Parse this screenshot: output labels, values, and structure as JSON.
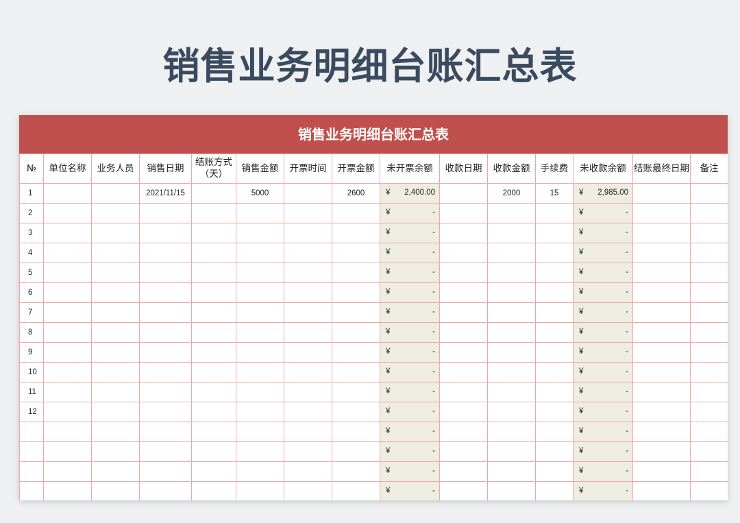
{
  "title": "销售业务明细台账汇总表",
  "sheet_title": "销售业务明细台账汇总表",
  "columns": [
    "№",
    "单位名称",
    "业务人员",
    "销售日期",
    "结账方式（天）",
    "销售金额",
    "开票时间",
    "开票金额",
    "未开票余额",
    "收款日期",
    "收款金额",
    "手续费",
    "未收款余额",
    "结账最终日期",
    "备注"
  ],
  "rows": [
    {
      "no": "1",
      "unit": "",
      "staff": "",
      "sale_date": "2021/11/15",
      "terms": "",
      "sale_amount": "5000",
      "invoice_time": "",
      "invoice_amount": "2600",
      "uninvoiced_symbol": "¥",
      "uninvoiced": "2,400.00",
      "receipt_date": "",
      "receipt_amount": "2000",
      "fee": "15",
      "unreceived_symbol": "¥",
      "unreceived": "2,985.00",
      "final_date": "",
      "note": ""
    },
    {
      "no": "2",
      "unit": "",
      "staff": "",
      "sale_date": "",
      "terms": "",
      "sale_amount": "",
      "invoice_time": "",
      "invoice_amount": "",
      "uninvoiced_symbol": "¥",
      "uninvoiced": "-",
      "receipt_date": "",
      "receipt_amount": "",
      "fee": "",
      "unreceived_symbol": "¥",
      "unreceived": "-",
      "final_date": "",
      "note": ""
    },
    {
      "no": "3",
      "unit": "",
      "staff": "",
      "sale_date": "",
      "terms": "",
      "sale_amount": "",
      "invoice_time": "",
      "invoice_amount": "",
      "uninvoiced_symbol": "¥",
      "uninvoiced": "-",
      "receipt_date": "",
      "receipt_amount": "",
      "fee": "",
      "unreceived_symbol": "¥",
      "unreceived": "-",
      "final_date": "",
      "note": ""
    },
    {
      "no": "4",
      "unit": "",
      "staff": "",
      "sale_date": "",
      "terms": "",
      "sale_amount": "",
      "invoice_time": "",
      "invoice_amount": "",
      "uninvoiced_symbol": "¥",
      "uninvoiced": "-",
      "receipt_date": "",
      "receipt_amount": "",
      "fee": "",
      "unreceived_symbol": "¥",
      "unreceived": "-",
      "final_date": "",
      "note": ""
    },
    {
      "no": "5",
      "unit": "",
      "staff": "",
      "sale_date": "",
      "terms": "",
      "sale_amount": "",
      "invoice_time": "",
      "invoice_amount": "",
      "uninvoiced_symbol": "¥",
      "uninvoiced": "-",
      "receipt_date": "",
      "receipt_amount": "",
      "fee": "",
      "unreceived_symbol": "¥",
      "unreceived": "-",
      "final_date": "",
      "note": ""
    },
    {
      "no": "6",
      "unit": "",
      "staff": "",
      "sale_date": "",
      "terms": "",
      "sale_amount": "",
      "invoice_time": "",
      "invoice_amount": "",
      "uninvoiced_symbol": "¥",
      "uninvoiced": "-",
      "receipt_date": "",
      "receipt_amount": "",
      "fee": "",
      "unreceived_symbol": "¥",
      "unreceived": "-",
      "final_date": "",
      "note": ""
    },
    {
      "no": "7",
      "unit": "",
      "staff": "",
      "sale_date": "",
      "terms": "",
      "sale_amount": "",
      "invoice_time": "",
      "invoice_amount": "",
      "uninvoiced_symbol": "¥",
      "uninvoiced": "-",
      "receipt_date": "",
      "receipt_amount": "",
      "fee": "",
      "unreceived_symbol": "¥",
      "unreceived": "-",
      "final_date": "",
      "note": ""
    },
    {
      "no": "8",
      "unit": "",
      "staff": "",
      "sale_date": "",
      "terms": "",
      "sale_amount": "",
      "invoice_time": "",
      "invoice_amount": "",
      "uninvoiced_symbol": "¥",
      "uninvoiced": "-",
      "receipt_date": "",
      "receipt_amount": "",
      "fee": "",
      "unreceived_symbol": "¥",
      "unreceived": "-",
      "final_date": "",
      "note": ""
    },
    {
      "no": "9",
      "unit": "",
      "staff": "",
      "sale_date": "",
      "terms": "",
      "sale_amount": "",
      "invoice_time": "",
      "invoice_amount": "",
      "uninvoiced_symbol": "¥",
      "uninvoiced": "-",
      "receipt_date": "",
      "receipt_amount": "",
      "fee": "",
      "unreceived_symbol": "¥",
      "unreceived": "-",
      "final_date": "",
      "note": ""
    },
    {
      "no": "10",
      "unit": "",
      "staff": "",
      "sale_date": "",
      "terms": "",
      "sale_amount": "",
      "invoice_time": "",
      "invoice_amount": "",
      "uninvoiced_symbol": "¥",
      "uninvoiced": "-",
      "receipt_date": "",
      "receipt_amount": "",
      "fee": "",
      "unreceived_symbol": "¥",
      "unreceived": "-",
      "final_date": "",
      "note": ""
    },
    {
      "no": "11",
      "unit": "",
      "staff": "",
      "sale_date": "",
      "terms": "",
      "sale_amount": "",
      "invoice_time": "",
      "invoice_amount": "",
      "uninvoiced_symbol": "¥",
      "uninvoiced": "-",
      "receipt_date": "",
      "receipt_amount": "",
      "fee": "",
      "unreceived_symbol": "¥",
      "unreceived": "-",
      "final_date": "",
      "note": ""
    },
    {
      "no": "12",
      "unit": "",
      "staff": "",
      "sale_date": "",
      "terms": "",
      "sale_amount": "",
      "invoice_time": "",
      "invoice_amount": "",
      "uninvoiced_symbol": "¥",
      "uninvoiced": "-",
      "receipt_date": "",
      "receipt_amount": "",
      "fee": "",
      "unreceived_symbol": "¥",
      "unreceived": "-",
      "final_date": "",
      "note": ""
    },
    {
      "no": "",
      "unit": "",
      "staff": "",
      "sale_date": "",
      "terms": "",
      "sale_amount": "",
      "invoice_time": "",
      "invoice_amount": "",
      "uninvoiced_symbol": "¥",
      "uninvoiced": "-",
      "receipt_date": "",
      "receipt_amount": "",
      "fee": "",
      "unreceived_symbol": "¥",
      "unreceived": "-",
      "final_date": "",
      "note": ""
    },
    {
      "no": "",
      "unit": "",
      "staff": "",
      "sale_date": "",
      "terms": "",
      "sale_amount": "",
      "invoice_time": "",
      "invoice_amount": "",
      "uninvoiced_symbol": "¥",
      "uninvoiced": "-",
      "receipt_date": "",
      "receipt_amount": "",
      "fee": "",
      "unreceived_symbol": "¥",
      "unreceived": "-",
      "final_date": "",
      "note": ""
    },
    {
      "no": "",
      "unit": "",
      "staff": "",
      "sale_date": "",
      "terms": "",
      "sale_amount": "",
      "invoice_time": "",
      "invoice_amount": "",
      "uninvoiced_symbol": "¥",
      "uninvoiced": "-",
      "receipt_date": "",
      "receipt_amount": "",
      "fee": "",
      "unreceived_symbol": "¥",
      "unreceived": "-",
      "final_date": "",
      "note": ""
    },
    {
      "no": "",
      "unit": "",
      "staff": "",
      "sale_date": "",
      "terms": "",
      "sale_amount": "",
      "invoice_time": "",
      "invoice_amount": "",
      "uninvoiced_symbol": "¥",
      "uninvoiced": "-",
      "receipt_date": "",
      "receipt_amount": "",
      "fee": "",
      "unreceived_symbol": "¥",
      "unreceived": "-",
      "final_date": "",
      "note": ""
    }
  ],
  "colors": {
    "header_red": "#c0504d",
    "grid_line": "#f0a7a9",
    "shaded_cell": "#efece1",
    "title_text": "#3b4a5f"
  }
}
